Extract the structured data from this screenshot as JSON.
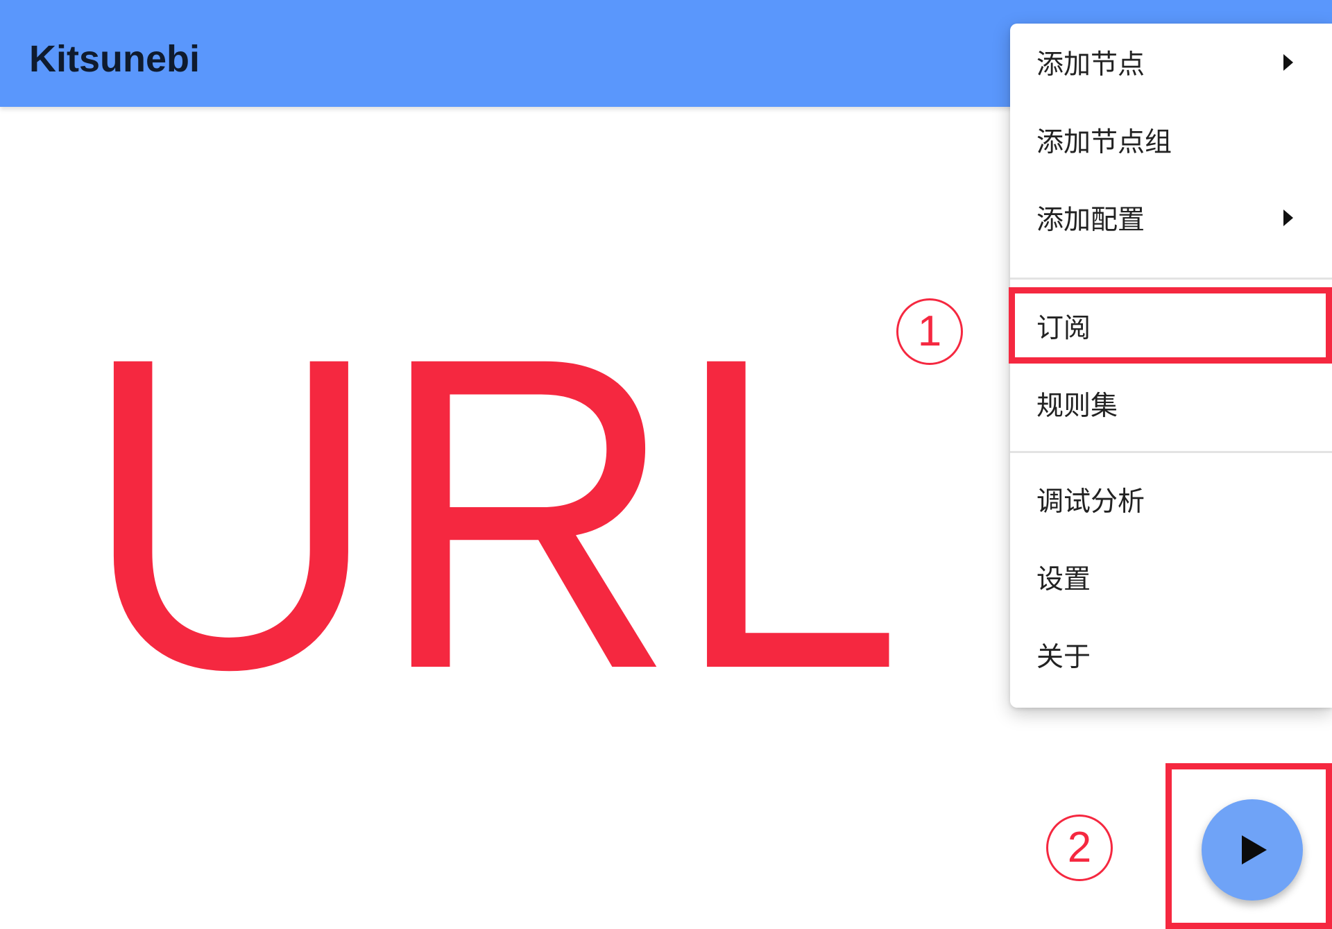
{
  "app": {
    "title": "Kitsunebi"
  },
  "content": {
    "big_text": "URL"
  },
  "menu": {
    "items": [
      {
        "label": "添加节点",
        "submenu": true
      },
      {
        "label": "添加节点组",
        "submenu": false
      },
      {
        "label": "添加配置",
        "submenu": true
      },
      {
        "label": "订阅",
        "submenu": false,
        "highlighted": true
      },
      {
        "label": "规则集",
        "submenu": false
      },
      {
        "label": "调试分析",
        "submenu": false
      },
      {
        "label": "设置",
        "submenu": false
      },
      {
        "label": "关于",
        "submenu": false
      }
    ]
  },
  "annotations": {
    "step1": "1",
    "step2": "2"
  },
  "fab": {
    "icon": "play-icon"
  },
  "colors": {
    "appbar": "#5a97fc",
    "annotation_red": "#f52840",
    "fab": "#6fa3f7",
    "menu_text": "#222222"
  }
}
